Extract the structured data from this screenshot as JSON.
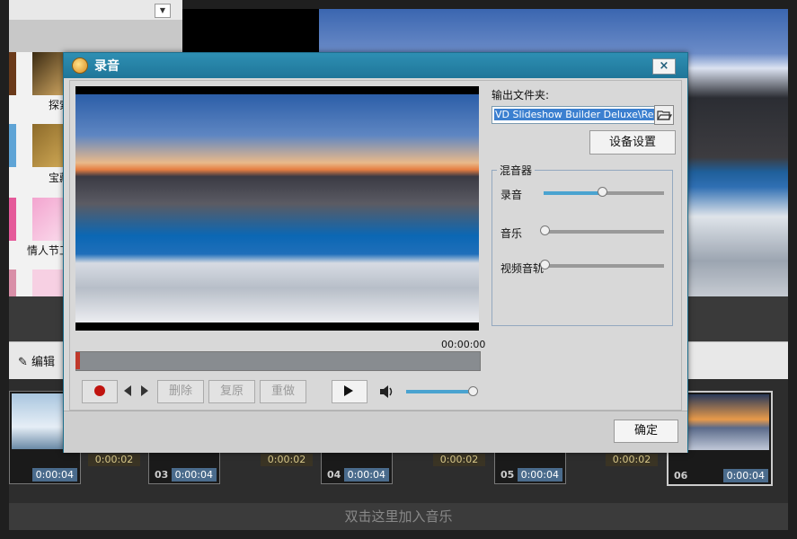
{
  "background_app": {
    "left_panel_items": [
      {
        "label": "探索"
      },
      {
        "label": "宝藏"
      },
      {
        "label": "情人节工"
      }
    ],
    "edit_label": "编辑",
    "music_hint": "双击这里加入音乐",
    "clips": [
      {
        "number": "",
        "duration": "0:00:04"
      },
      {
        "number": "03",
        "duration": "0:00:04"
      },
      {
        "number": "04",
        "duration": "0:00:04"
      },
      {
        "number": "05",
        "duration": "0:00:04"
      },
      {
        "number": "06",
        "duration": "0:00:04"
      }
    ],
    "transitions": [
      "0:00:02",
      "0:00:02",
      "0:00:02",
      "0:00:02"
    ]
  },
  "dialog": {
    "title": "录音",
    "close_label": "×",
    "time": "00:00:00",
    "controls": {
      "delete_label": "删除",
      "restore_label": "复原",
      "redo_label": "重做"
    },
    "volume_level": 1.0,
    "output_folder": {
      "label": "输出文件夹:",
      "value": "VD Slideshow Builder Deluxe\\Record\\"
    },
    "device_settings_label": "设备设置",
    "mixer": {
      "title": "混音器",
      "channels": [
        {
          "label": "录音",
          "level": 0.48
        },
        {
          "label": "音乐",
          "level": 0.0
        },
        {
          "label": "视频音轨",
          "level": 0.0
        }
      ]
    },
    "ok_label": "确定"
  },
  "colors": {
    "title_bar": "#1f7699",
    "accent": "#4aa3d0",
    "record": "#c0140f"
  }
}
